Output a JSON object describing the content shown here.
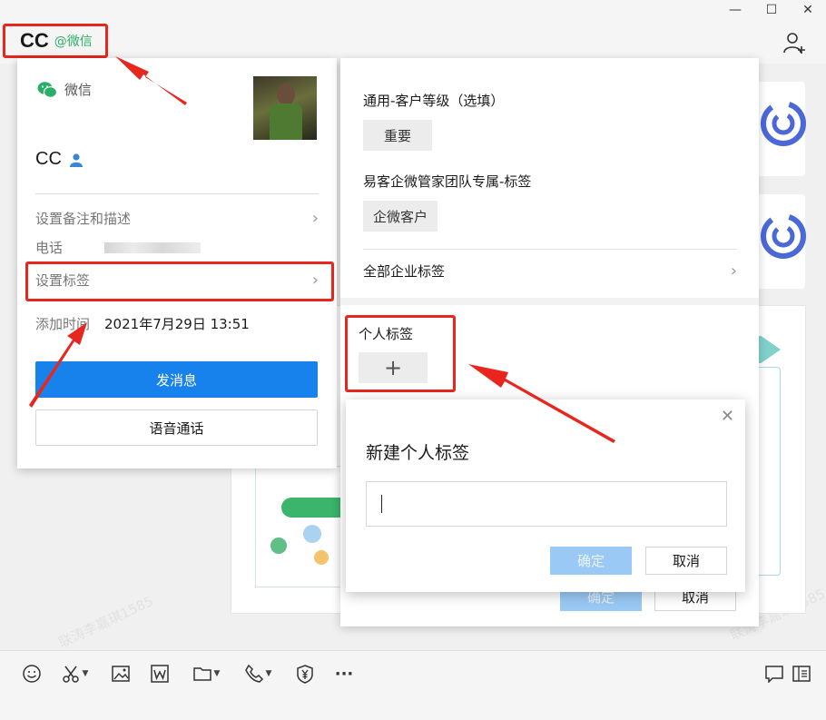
{
  "chat": {
    "name": "CC",
    "source": "@微信"
  },
  "profile": {
    "wechat_label": "微信",
    "name": "CC",
    "remark_label": "设置备注和描述",
    "phone_label": "电话",
    "tags_label": "设置标签",
    "add_time_label": "添加时间",
    "add_time_value": "2021年7月29日 13:51",
    "send_button": "发消息",
    "voice_button": "语音通话"
  },
  "tag_panel": {
    "group1_title": "通用-客户等级（选填）",
    "group1_tag": "重要",
    "group2_title": "易客企微管家团队专属-标签",
    "group2_tag": "企微客户",
    "all_tags_label": "全部企业标签",
    "personal_title": "个人标签",
    "add_symbol": "+",
    "confirm_label": "确定",
    "cancel_label": "取消"
  },
  "dialog": {
    "title": "新建个人标签",
    "input_value": "",
    "confirm_label": "确定",
    "cancel_label": "取消",
    "close_symbol": "✕"
  },
  "background": {
    "watermark": "联涛李嘉琪1585"
  },
  "window": {
    "minimize": "—",
    "maximize": "☐",
    "close": "✕"
  },
  "toolbar": {
    "more_symbol": "···",
    "icons": [
      "emoji-icon",
      "screenshot-icon",
      "image-icon",
      "word-doc-icon",
      "folder-icon",
      "phone-icon",
      "red-packet-icon",
      "more-icon",
      "chat-record-icon",
      "sidebar-icon"
    ]
  },
  "colors": {
    "annotation_red": "#e8261e",
    "wechat_green": "#2aae67",
    "primary_blue": "#1882ec",
    "disabled_blue": "#9ac9f5"
  }
}
